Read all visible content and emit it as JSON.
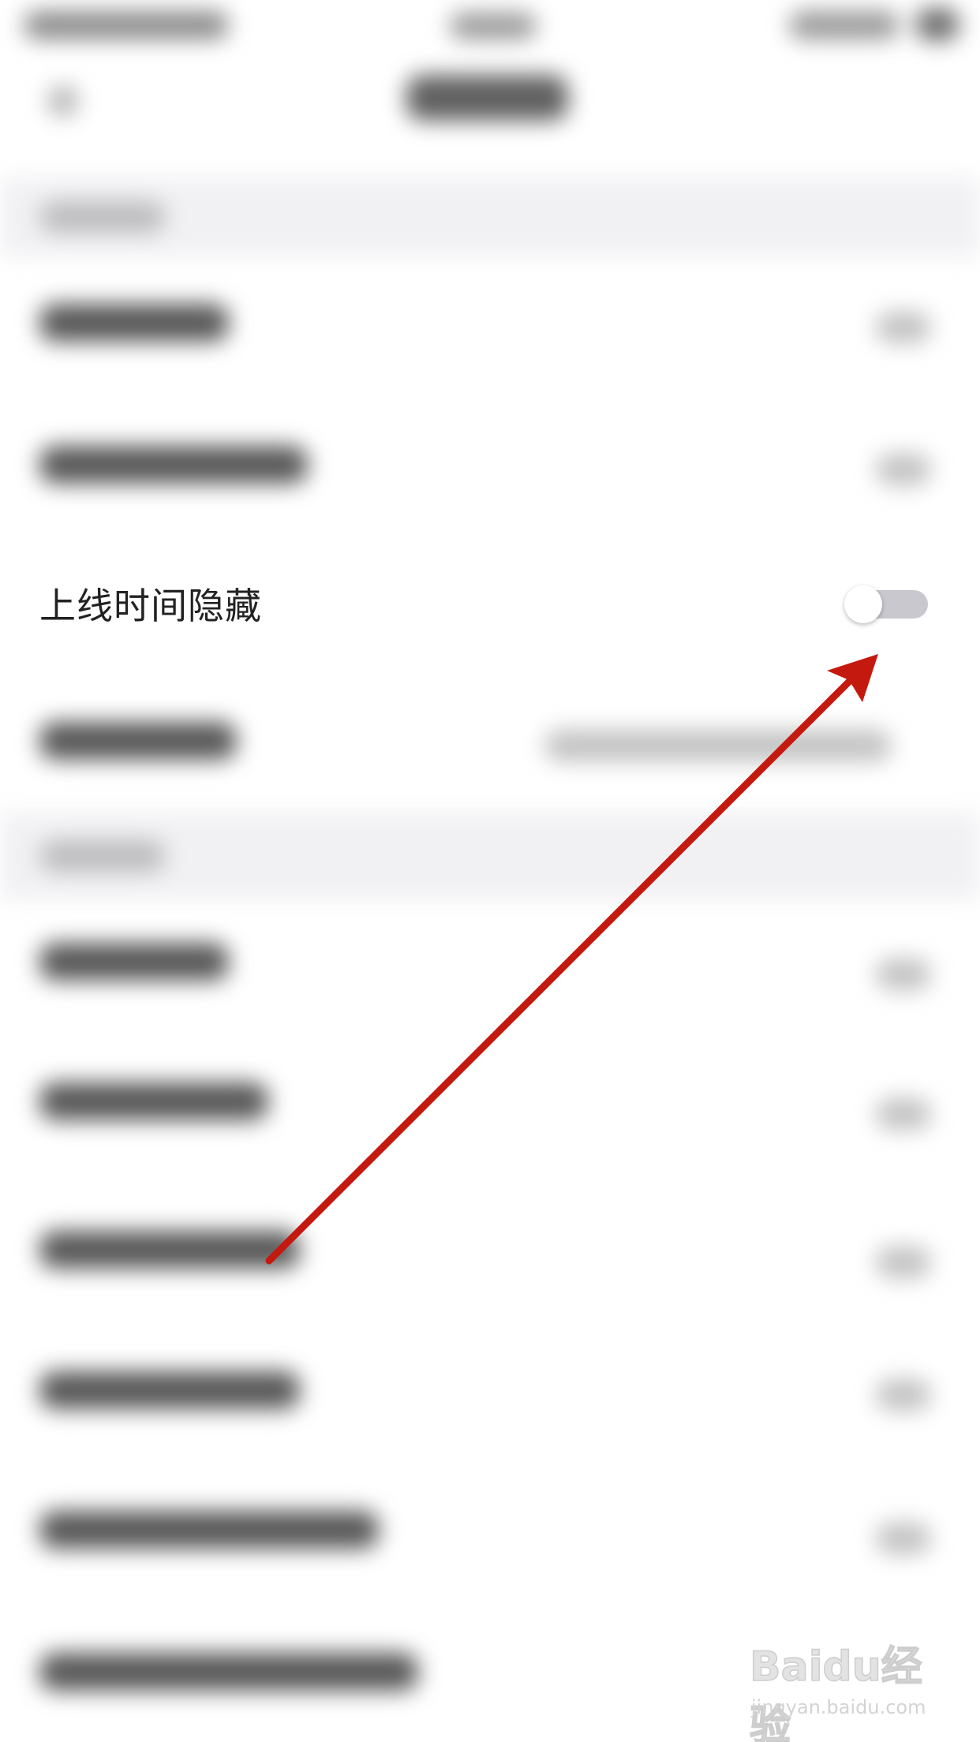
{
  "settings": {
    "online_time_hidden": {
      "label": "上线时间隐藏",
      "enabled": false
    }
  },
  "colors": {
    "toggle_track_off": "#c9c8cf",
    "toggle_knob": "#ffffff",
    "arrow": "#c4190f",
    "label_text": "#222222"
  },
  "watermark": {
    "brand": "Baidu经验",
    "url": "jingyan.baidu.com"
  }
}
